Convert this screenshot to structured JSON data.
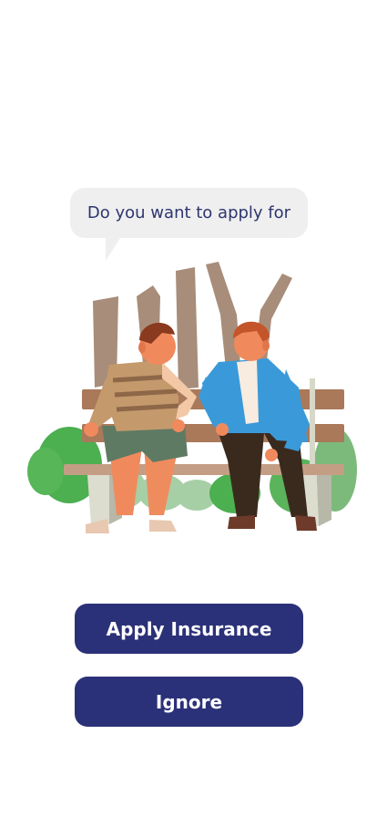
{
  "prompt": {
    "text": "Do you want to apply for"
  },
  "illustration": {
    "icon": "two-people-on-bench-illustration"
  },
  "actions": {
    "apply_label": "Apply Insurance",
    "ignore_label": "Ignore"
  },
  "colors": {
    "button_bg": "#2b3178",
    "button_text": "#ffffff",
    "bubble_bg": "#efefef",
    "bubble_text": "#2e3570"
  }
}
